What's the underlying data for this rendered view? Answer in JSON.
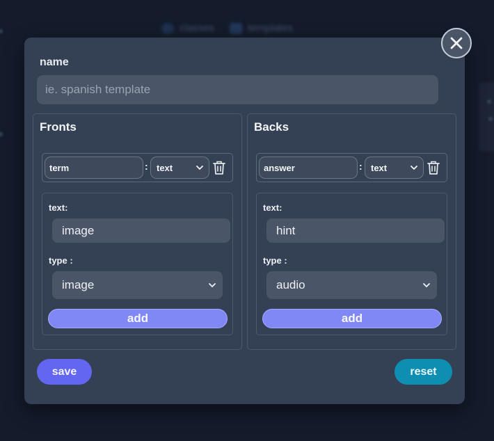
{
  "background_nav": {
    "items": [
      {
        "label": "classes",
        "icon": "classes-icon"
      },
      {
        "label": "templates",
        "icon": "templates-icon"
      }
    ]
  },
  "modal": {
    "close_icon": "close-icon",
    "name_label": "name",
    "name_placeholder": "ie. spanish template",
    "name_value": "",
    "panels": {
      "fronts": {
        "title": "Fronts",
        "field_name": "term",
        "field_type": "text",
        "sub": {
          "text_label": "text:",
          "text_value": "image",
          "type_label": "type :",
          "type_value": "image",
          "add_label": "add"
        }
      },
      "backs": {
        "title": "Backs",
        "field_name": "answer",
        "field_type": "text",
        "sub": {
          "text_label": "text:",
          "text_value": "hint",
          "type_label": "type :",
          "type_value": "audio",
          "add_label": "add"
        }
      }
    },
    "save_label": "save",
    "reset_label": "reset"
  },
  "colors": {
    "page_bg": "#141b2b",
    "modal_bg": "#344154",
    "input_bg": "#4a5568",
    "save": "#6366f1",
    "reset": "#0e8fb1",
    "add": "#8088f5"
  }
}
